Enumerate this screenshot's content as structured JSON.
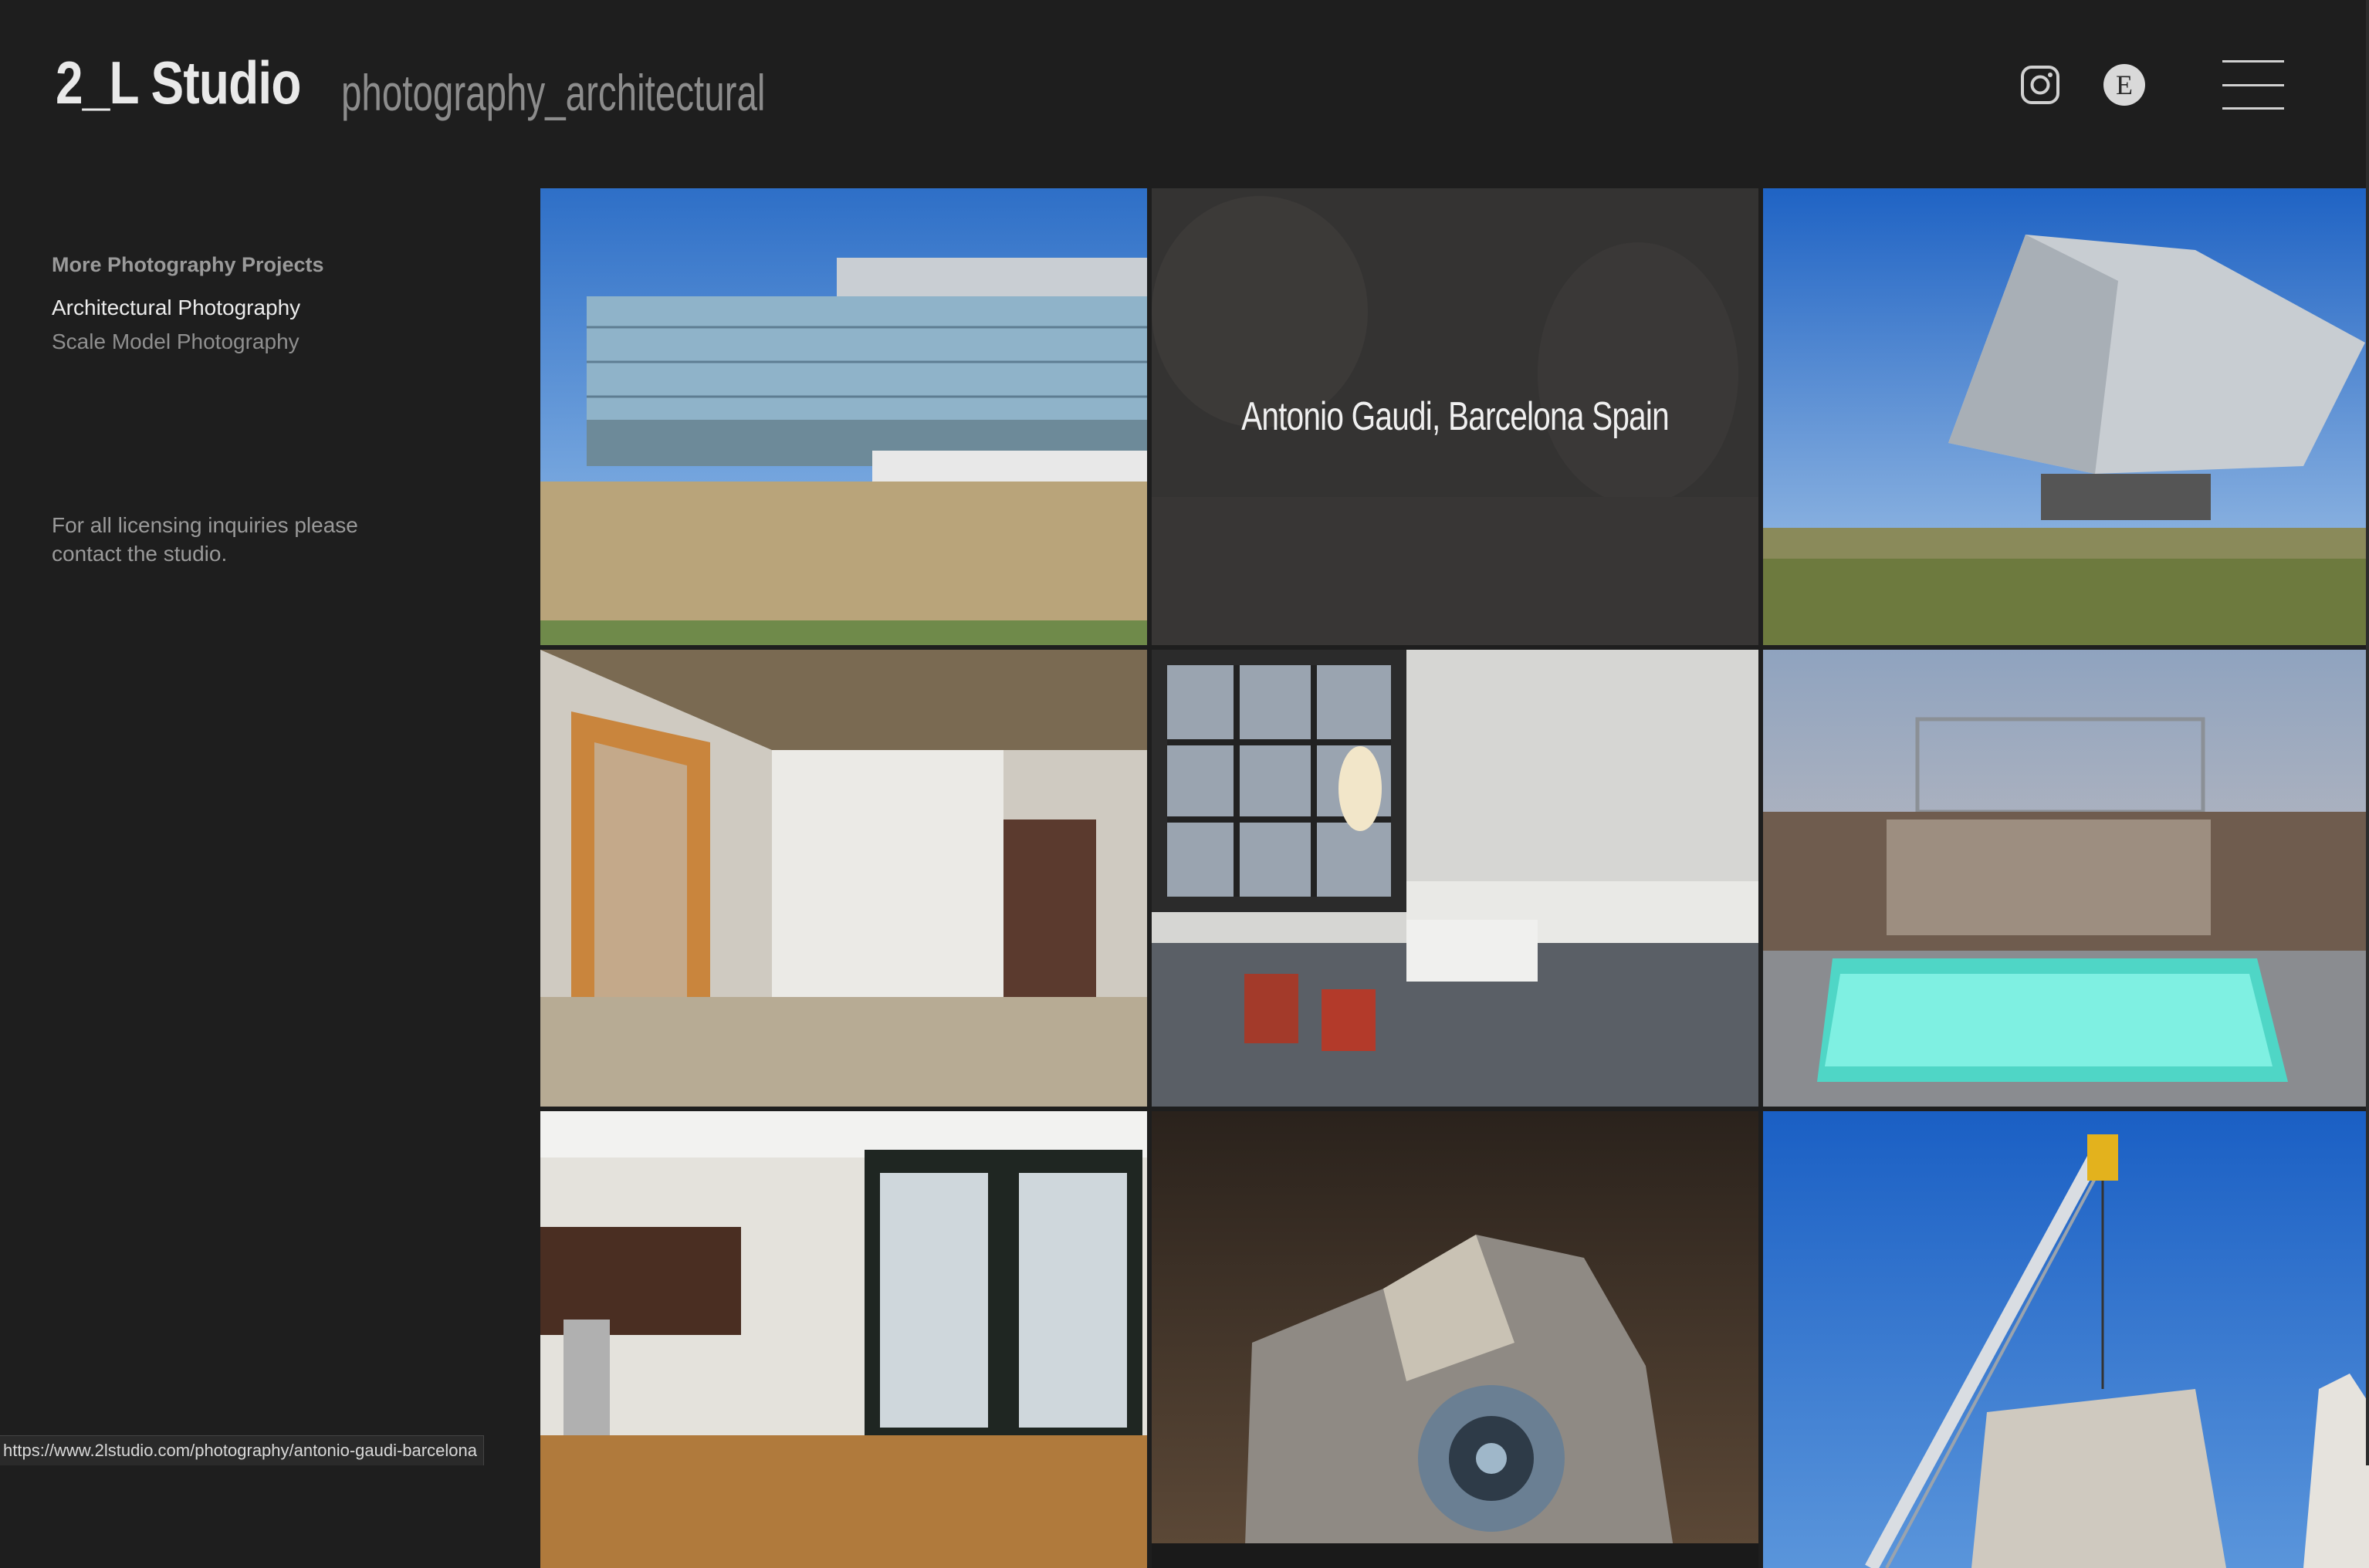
{
  "header": {
    "brand_name": "2_L Studio",
    "brand_tagline": "photography_architectural",
    "icons": [
      "instagram-icon",
      "etsy-icon",
      "hamburger-menu-icon"
    ],
    "etsy_letter": "E"
  },
  "sidebar": {
    "heading": "More Photography Projects",
    "links": [
      {
        "label": "Architectural Photography",
        "active": true
      },
      {
        "label": "Scale Model Photography",
        "active": false
      }
    ],
    "note": "For all licensing inquiries please contact the studio."
  },
  "gallery": {
    "hover_caption": "Antonio Gaudi, Barcelona Spain"
  },
  "status_bar": {
    "url": "https://www.2lstudio.com/photography/antonio-gaudi-barcelona"
  },
  "colors": {
    "background": "#1e1e1e",
    "brand_text": "#e9e9e9",
    "muted_text": "#8f8f8f"
  }
}
